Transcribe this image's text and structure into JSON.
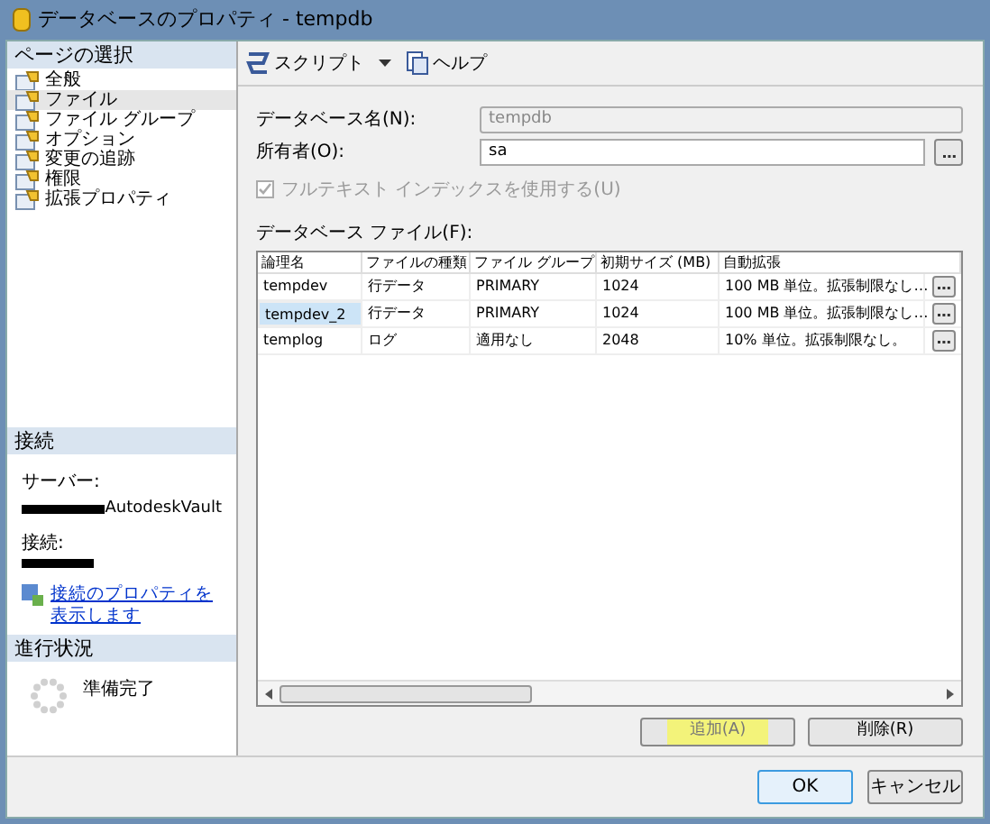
{
  "window": {
    "title": "データベースのプロパティ - tempdb"
  },
  "page_select": {
    "title": "ページの選択",
    "items": [
      {
        "label": "全般",
        "selected": false
      },
      {
        "label": "ファイル",
        "selected": true
      },
      {
        "label": "ファイル グループ",
        "selected": false
      },
      {
        "label": "オプション",
        "selected": false
      },
      {
        "label": "変更の追跡",
        "selected": false
      },
      {
        "label": "権限",
        "selected": false
      },
      {
        "label": "拡張プロパティ",
        "selected": false
      }
    ]
  },
  "connection": {
    "title": "接続",
    "server_label": "サーバー:",
    "server_value": "AutodeskVault",
    "connection_label": "接続:",
    "link": "接続のプロパティを表示します"
  },
  "progress": {
    "title": "進行状況",
    "status": "準備完了"
  },
  "toolbar": {
    "script": "スクリプト",
    "help": "ヘルプ"
  },
  "form": {
    "name_label": "データベース名(N):",
    "name_value": "tempdb",
    "name_disabled": true,
    "owner_label": "所有者(O):",
    "owner_value": "sa",
    "fulltext": {
      "label": "フルテキスト インデックスを使用する(U)",
      "checked": true,
      "disabled": true
    }
  },
  "files": {
    "label": "データベース ファイル(F):",
    "columns": [
      "論理名",
      "ファイルの種類",
      "ファイル グループ",
      "初期サイズ (MB)",
      "自動拡張"
    ],
    "rows": [
      {
        "cells": [
          "tempdev",
          "行データ",
          "PRIMARY",
          "1024",
          "100 MB 単位。拡張制限なし…"
        ],
        "selected": false
      },
      {
        "cells": [
          "tempdev_2",
          "行データ",
          "PRIMARY",
          "1024",
          "100 MB 単位。拡張制限なし…"
        ],
        "selected": true
      },
      {
        "cells": [
          "templog",
          "ログ",
          "適用なし",
          "2048",
          "10% 単位。拡張制限なし。"
        ],
        "selected": false
      }
    ]
  },
  "buttons": [
    {
      "label": "追加(A)",
      "highlighted": true
    },
    {
      "label": "削除(R)",
      "highlighted": false
    }
  ],
  "dialog_buttons": [
    {
      "label": "OK",
      "default": true
    },
    {
      "label": "キャンセル",
      "default": false
    }
  ]
}
